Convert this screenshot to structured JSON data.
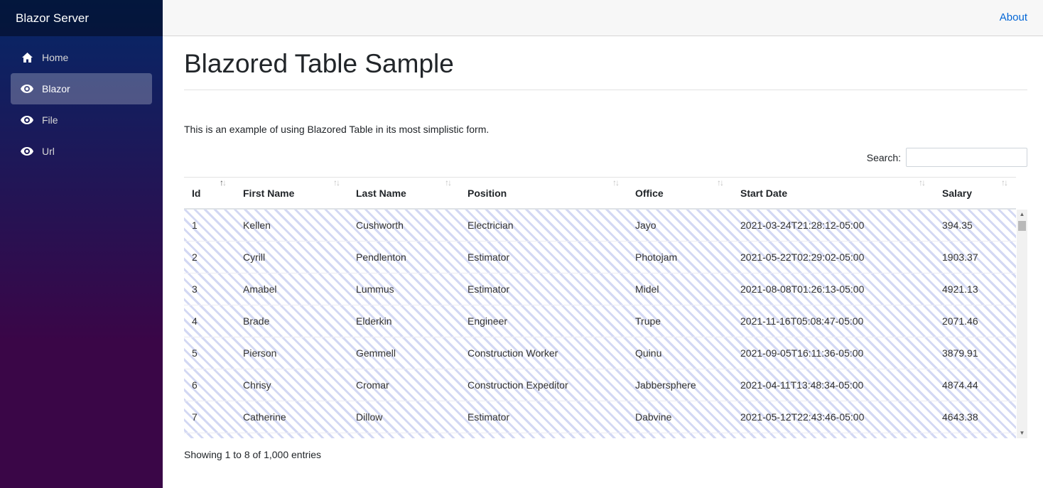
{
  "app": {
    "brand": "Blazor Server"
  },
  "sidebar": {
    "items": [
      {
        "label": "Home",
        "icon": "home-icon",
        "active": false
      },
      {
        "label": "Blazor",
        "icon": "eye-icon",
        "active": true
      },
      {
        "label": "File",
        "icon": "eye-icon",
        "active": false
      },
      {
        "label": "Url",
        "icon": "eye-icon",
        "active": false
      }
    ]
  },
  "header": {
    "about": "About"
  },
  "main": {
    "title": "Blazored Table Sample",
    "intro": "This is an example of using Blazored Table in its most simplistic form.",
    "search": {
      "label": "Search:",
      "value": "",
      "placeholder": ""
    },
    "footer": "Showing 1 to 8 of 1,000 entries"
  },
  "table": {
    "columns": [
      "Id",
      "First Name",
      "Last Name",
      "Position",
      "Office",
      "Start Date",
      "Salary"
    ],
    "rows": [
      [
        "1",
        "Kellen",
        "Cushworth",
        "Electrician",
        "Jayo",
        "2021-03-24T21:28:12-05:00",
        "394.35"
      ],
      [
        "2",
        "Cyrill",
        "Pendlenton",
        "Estimator",
        "Photojam",
        "2021-05-22T02:29:02-05:00",
        "1903.37"
      ],
      [
        "3",
        "Amabel",
        "Lummus",
        "Estimator",
        "Midel",
        "2021-08-08T01:26:13-05:00",
        "4921.13"
      ],
      [
        "4",
        "Brade",
        "Elderkin",
        "Engineer",
        "Trupe",
        "2021-11-16T05:08:47-05:00",
        "2071.46"
      ],
      [
        "5",
        "Pierson",
        "Gemmell",
        "Construction Worker",
        "Quinu",
        "2021-09-05T16:11:36-05:00",
        "3879.91"
      ],
      [
        "6",
        "Chrisy",
        "Cromar",
        "Construction Expeditor",
        "Jabbersphere",
        "2021-04-11T13:48:34-05:00",
        "4874.44"
      ],
      [
        "7",
        "Catherine",
        "Dillow",
        "Estimator",
        "Dabvine",
        "2021-05-12T22:43:46-05:00",
        "4643.38"
      ]
    ],
    "sort_active_column": "Id"
  },
  "colors": {
    "sidebar_top": "#052767",
    "sidebar_bottom": "#3a0647",
    "link": "#0366d6",
    "stripe": "#d3d8f3"
  }
}
